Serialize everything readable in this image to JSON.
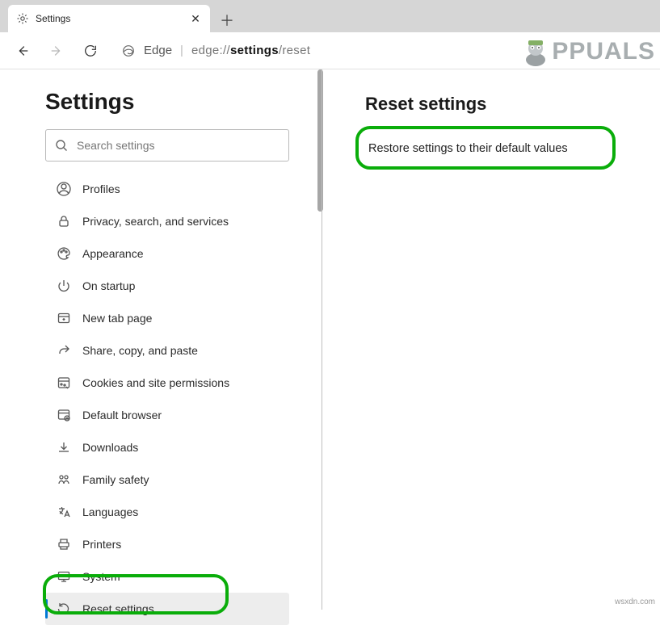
{
  "tab": {
    "title": "Settings"
  },
  "address": {
    "label": "Edge",
    "url_prefix": "edge://",
    "url_mid": "settings",
    "url_suffix": "/reset"
  },
  "sidebar": {
    "heading": "Settings",
    "search_placeholder": "Search settings",
    "items": [
      {
        "label": "Profiles",
        "icon": "profile-icon",
        "active": false
      },
      {
        "label": "Privacy, search, and services",
        "icon": "lock-icon",
        "active": false
      },
      {
        "label": "Appearance",
        "icon": "appearance-icon",
        "active": false
      },
      {
        "label": "On startup",
        "icon": "power-icon",
        "active": false
      },
      {
        "label": "New tab page",
        "icon": "newtab-icon",
        "active": false
      },
      {
        "label": "Share, copy, and paste",
        "icon": "share-icon",
        "active": false
      },
      {
        "label": "Cookies and site permissions",
        "icon": "cookies-icon",
        "active": false
      },
      {
        "label": "Default browser",
        "icon": "defaultbrowser-icon",
        "active": false
      },
      {
        "label": "Downloads",
        "icon": "download-icon",
        "active": false
      },
      {
        "label": "Family safety",
        "icon": "family-icon",
        "active": false
      },
      {
        "label": "Languages",
        "icon": "languages-icon",
        "active": false
      },
      {
        "label": "Printers",
        "icon": "printer-icon",
        "active": false
      },
      {
        "label": "System",
        "icon": "system-icon",
        "active": false
      },
      {
        "label": "Reset settings",
        "icon": "reset-icon",
        "active": true
      }
    ]
  },
  "main": {
    "heading": "Reset settings",
    "restore_label": "Restore settings to their default values"
  },
  "watermark": "PPUALS",
  "footer": "wsxdn.com"
}
